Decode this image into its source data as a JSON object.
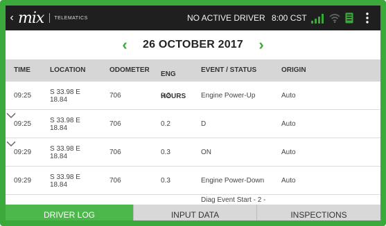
{
  "statusbar": {
    "brand": "mix",
    "brand_sub": "TELEMATICS",
    "driver_status": "NO ACTIVE DRIVER",
    "time": "8:00 CST",
    "icons": [
      "back-arrow-icon",
      "signal-icon",
      "wifi-icon",
      "document-icon",
      "kebab-menu-icon"
    ],
    "accent": "#3aa83a"
  },
  "date_nav": {
    "prev": "‹",
    "title": "26 OCTOBER 2017",
    "next": "›"
  },
  "table": {
    "headers": {
      "time": "TIME",
      "location": "LOCATION",
      "odometer": "ODOMETER",
      "eng1": "ENG",
      "eng2": "HOURS",
      "event": "EVENT / STATUS",
      "origin": "ORIGIN"
    },
    "rows": [
      {
        "time": "09:25",
        "loc1": "S 33.98 E",
        "loc2": "18.84",
        "odometer": "706",
        "eng": "0.2",
        "event": "Engine Power-Up",
        "origin": "Auto",
        "expandable": false
      },
      {
        "time": "09:25",
        "loc1": "S 33.98 E",
        "loc2": "18.84",
        "odometer": "706",
        "eng": "0.2",
        "event": "D",
        "origin": "Auto",
        "expandable": true
      },
      {
        "time": "09:29",
        "loc1": "S 33.98 E",
        "loc2": "18.84",
        "odometer": "706",
        "eng": "0.3",
        "event": "ON",
        "origin": "Auto",
        "expandable": true
      },
      {
        "time": "09:29",
        "loc1": "S 33.98 E",
        "loc2": "18.84",
        "odometer": "706",
        "eng": "0.3",
        "event": "Engine Power-Down",
        "origin": "Auto",
        "expandable": false
      }
    ],
    "partial_row_event": "Diag Event Start - 2 -"
  },
  "tabs": [
    {
      "label": "DRIVER LOG",
      "active": true
    },
    {
      "label": "INPUT DATA",
      "active": false
    },
    {
      "label": "INSPECTIONS",
      "active": false
    }
  ]
}
